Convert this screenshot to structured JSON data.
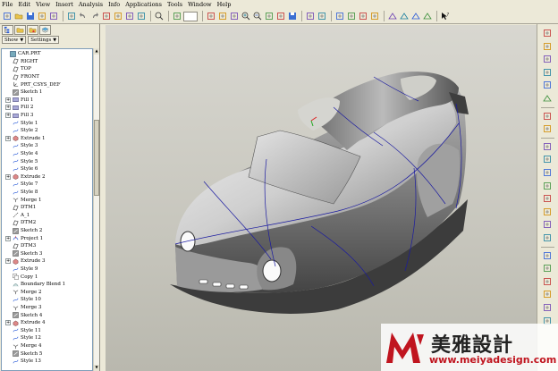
{
  "menu": [
    "File",
    "Edit",
    "View",
    "Insert",
    "Analysis",
    "Info",
    "Applications",
    "Tools",
    "Window",
    "Help"
  ],
  "panel": {
    "tabs": [
      "model-tree-tab",
      "folder-tab",
      "favorites-tab",
      "layers-tab"
    ],
    "show_label": "Show",
    "settings_label": "Settings"
  },
  "tree": [
    {
      "label": "CAR.PRT",
      "icon": "part",
      "expand": "none",
      "indent": 0
    },
    {
      "label": "RIGHT",
      "icon": "datum-plane",
      "expand": "none",
      "indent": 1
    },
    {
      "label": "TOP",
      "icon": "datum-plane",
      "expand": "none",
      "indent": 1
    },
    {
      "label": "FRONT",
      "icon": "datum-plane",
      "expand": "none",
      "indent": 1
    },
    {
      "label": "PRT_CSYS_DEF",
      "icon": "csys",
      "expand": "none",
      "indent": 1
    },
    {
      "label": "Sketch 1",
      "icon": "sketch",
      "expand": "none",
      "indent": 1
    },
    {
      "label": "Fill 1",
      "icon": "fill",
      "expand": "plus",
      "indent": 1
    },
    {
      "label": "Fill 2",
      "icon": "fill",
      "expand": "plus",
      "indent": 1
    },
    {
      "label": "Fill 3",
      "icon": "fill",
      "expand": "plus",
      "indent": 1
    },
    {
      "label": "Style 1",
      "icon": "style",
      "expand": "none",
      "indent": 1
    },
    {
      "label": "Style 2",
      "icon": "style",
      "expand": "none",
      "indent": 1
    },
    {
      "label": "Extrude 1",
      "icon": "extrude",
      "expand": "plus",
      "indent": 1
    },
    {
      "label": "Style 3",
      "icon": "style",
      "expand": "none",
      "indent": 1
    },
    {
      "label": "Style 4",
      "icon": "style",
      "expand": "none",
      "indent": 1
    },
    {
      "label": "Style 5",
      "icon": "style",
      "expand": "none",
      "indent": 1
    },
    {
      "label": "Style 6",
      "icon": "style",
      "expand": "none",
      "indent": 1
    },
    {
      "label": "Extrude 2",
      "icon": "extrude",
      "expand": "plus",
      "indent": 1
    },
    {
      "label": "Style 7",
      "icon": "style",
      "expand": "none",
      "indent": 1
    },
    {
      "label": "Style 8",
      "icon": "style",
      "expand": "none",
      "indent": 1
    },
    {
      "label": "Merge 1",
      "icon": "merge",
      "expand": "none",
      "indent": 1
    },
    {
      "label": "DTM1",
      "icon": "datum-plane",
      "expand": "none",
      "indent": 1
    },
    {
      "label": "A_1",
      "icon": "axis",
      "expand": "none",
      "indent": 1
    },
    {
      "label": "DTM2",
      "icon": "datum-plane",
      "expand": "none",
      "indent": 1
    },
    {
      "label": "Sketch 2",
      "icon": "sketch",
      "expand": "none",
      "indent": 1
    },
    {
      "label": "Project 1",
      "icon": "project",
      "expand": "plus",
      "indent": 1
    },
    {
      "label": "DTM3",
      "icon": "datum-plane",
      "expand": "none",
      "indent": 1
    },
    {
      "label": "Sketch 3",
      "icon": "sketch",
      "expand": "none",
      "indent": 1
    },
    {
      "label": "Extrude 3",
      "icon": "extrude",
      "expand": "plus",
      "indent": 1
    },
    {
      "label": "Style 9",
      "icon": "style",
      "expand": "none",
      "indent": 1
    },
    {
      "label": "Copy 1",
      "icon": "copy",
      "expand": "none",
      "indent": 1
    },
    {
      "label": "Boundary Blend 1",
      "icon": "blend",
      "expand": "none",
      "indent": 1
    },
    {
      "label": "Merge 2",
      "icon": "merge",
      "expand": "none",
      "indent": 1
    },
    {
      "label": "Style 10",
      "icon": "style",
      "expand": "none",
      "indent": 1
    },
    {
      "label": "Merge 3",
      "icon": "merge",
      "expand": "none",
      "indent": 1
    },
    {
      "label": "Sketch 4",
      "icon": "sketch",
      "expand": "none",
      "indent": 1
    },
    {
      "label": "Extrude 4",
      "icon": "extrude",
      "expand": "plus",
      "indent": 1
    },
    {
      "label": "Style 11",
      "icon": "style",
      "expand": "none",
      "indent": 1
    },
    {
      "label": "Style 12",
      "icon": "style",
      "expand": "none",
      "indent": 1
    },
    {
      "label": "Merge 4",
      "icon": "merge",
      "expand": "none",
      "indent": 1
    },
    {
      "label": "Sketch 5",
      "icon": "sketch",
      "expand": "none",
      "indent": 1
    },
    {
      "label": "Style 13",
      "icon": "style",
      "expand": "none",
      "indent": 1
    }
  ],
  "toolbar_icons": [
    "new-icon",
    "open-icon",
    "save-icon",
    "print-icon",
    "email-icon",
    "cut-icon",
    "undo-icon",
    "redo-icon",
    "copy-icon",
    "paste-icon",
    "paste-special-icon",
    "regenerate-icon",
    "search-icon",
    "select-box-icon",
    "repaint-icon",
    "spin-center-icon",
    "orient-icon",
    "zoom-in-icon",
    "zoom-out-icon",
    "refit-icon",
    "reorient-icon",
    "saved-views-icon",
    "layers-icon",
    "view-manager-icon",
    "wireframe-icon",
    "hidden-line-icon",
    "no-hidden-icon",
    "shading-icon",
    "datum-planes-icon",
    "datum-axes-icon",
    "datum-points-icon",
    "csys-icon",
    "context-help-icon"
  ],
  "right_icons": [
    "sketch-tool-icon",
    "plane-tool-icon",
    "axis-tool-icon",
    "curve-tool-icon",
    "point-tool-icon",
    "csys-tool-icon",
    "analysis-tool-icon",
    "annotation-tool-icon",
    "hole-tool-icon",
    "shell-tool-icon",
    "rib-tool-icon",
    "draft-tool-icon",
    "round-tool-icon",
    "chamfer-tool-icon",
    "pattern-tool-icon",
    "mirror-tool-icon",
    "merge-tool-icon",
    "trim-tool-icon",
    "extend-tool-icon",
    "offset-tool-icon",
    "thicken-tool-icon",
    "solidify-tool-icon"
  ],
  "logo": {
    "brand": "美雅設計",
    "url": "www.meiyadesign.com",
    "accent": "#c0151f"
  },
  "colors": {
    "ui_face": "#ece9d8",
    "viewport_top": "#d8d7d0",
    "viewport_bottom": "#b9b8ae",
    "edge_curves": "#1a1aa0"
  }
}
